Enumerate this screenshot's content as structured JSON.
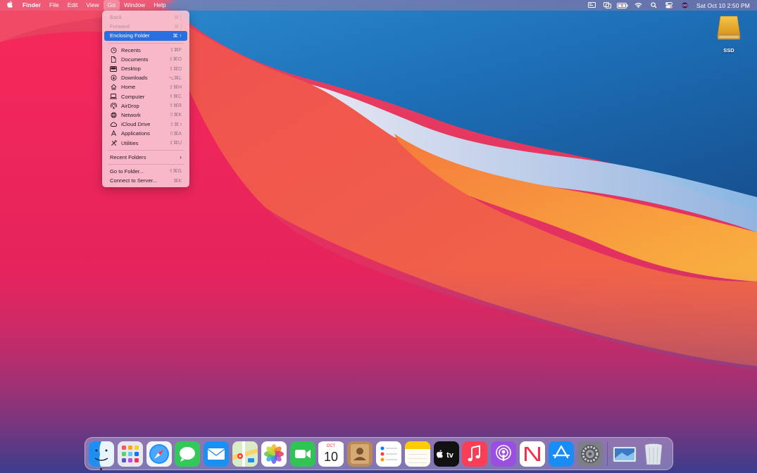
{
  "menubar": {
    "apple_icon": "apple-logo-icon",
    "app_name": "Finder",
    "menus": [
      "File",
      "Edit",
      "View",
      "Go",
      "Window",
      "Help"
    ],
    "open_menu": "Go",
    "status_icons": [
      "screen-mirroring-icon",
      "display-icon",
      "battery-icon",
      "wifi-icon",
      "search-icon",
      "control-center-icon",
      "siri-icon"
    ],
    "datetime": "Sat Oct 10  2:50 PM"
  },
  "go_menu": {
    "top_items": [
      {
        "label": "Back",
        "shortcut": "⌘ [",
        "enabled": false
      },
      {
        "label": "Forward",
        "shortcut": "⌘ ]",
        "enabled": false
      },
      {
        "label": "Enclosing Folder",
        "shortcut": "⌘ ↑",
        "enabled": true,
        "highlighted": true
      }
    ],
    "places": [
      {
        "label": "Recents",
        "shortcut": "⇧⌘F",
        "icon": "clock-icon"
      },
      {
        "label": "Documents",
        "shortcut": "⇧⌘O",
        "icon": "document-icon"
      },
      {
        "label": "Desktop",
        "shortcut": "⇧⌘D",
        "icon": "desktop-icon"
      },
      {
        "label": "Downloads",
        "shortcut": "⌥⌘L",
        "icon": "download-icon"
      },
      {
        "label": "Home",
        "shortcut": "⇧⌘H",
        "icon": "house-icon"
      },
      {
        "label": "Computer",
        "shortcut": "⇧⌘C",
        "icon": "laptop-icon"
      },
      {
        "label": "AirDrop",
        "shortcut": "⇧⌘R",
        "icon": "airdrop-icon"
      },
      {
        "label": "Network",
        "shortcut": "⇧⌘K",
        "icon": "globe-icon"
      },
      {
        "label": "iCloud Drive",
        "shortcut": "⇧⌘ I",
        "icon": "cloud-icon"
      },
      {
        "label": "Applications",
        "shortcut": "⇧⌘A",
        "icon": "applications-icon"
      },
      {
        "label": "Utilities",
        "shortcut": "⇧⌘U",
        "icon": "tools-icon"
      }
    ],
    "recent_folders": {
      "label": "Recent Folders",
      "submenu_icon": "chevron-right-icon"
    },
    "bottom_items": [
      {
        "label": "Go to Folder...",
        "shortcut": "⇧⌘G"
      },
      {
        "label": "Connect to Server...",
        "shortcut": "⌘K"
      }
    ]
  },
  "desktop": {
    "drive": {
      "label": "SSD",
      "icon": "external-drive-icon"
    }
  },
  "dock": {
    "apps": [
      {
        "name": "finder",
        "running": true
      },
      {
        "name": "launchpad"
      },
      {
        "name": "safari"
      },
      {
        "name": "messages"
      },
      {
        "name": "mail"
      },
      {
        "name": "maps"
      },
      {
        "name": "photos"
      },
      {
        "name": "facetime"
      },
      {
        "name": "calendar",
        "month": "OCT",
        "day": "10"
      },
      {
        "name": "contacts"
      },
      {
        "name": "reminders"
      },
      {
        "name": "notes"
      },
      {
        "name": "apple-tv",
        "label": "tv"
      },
      {
        "name": "music"
      },
      {
        "name": "podcasts"
      },
      {
        "name": "news"
      },
      {
        "name": "app-store"
      },
      {
        "name": "system-preferences"
      }
    ],
    "others": [
      {
        "name": "screenshot-stack"
      },
      {
        "name": "trash"
      }
    ]
  },
  "colors": {
    "menu_highlight": "#2a6fe0",
    "menu_background": "#f8c4d2"
  }
}
